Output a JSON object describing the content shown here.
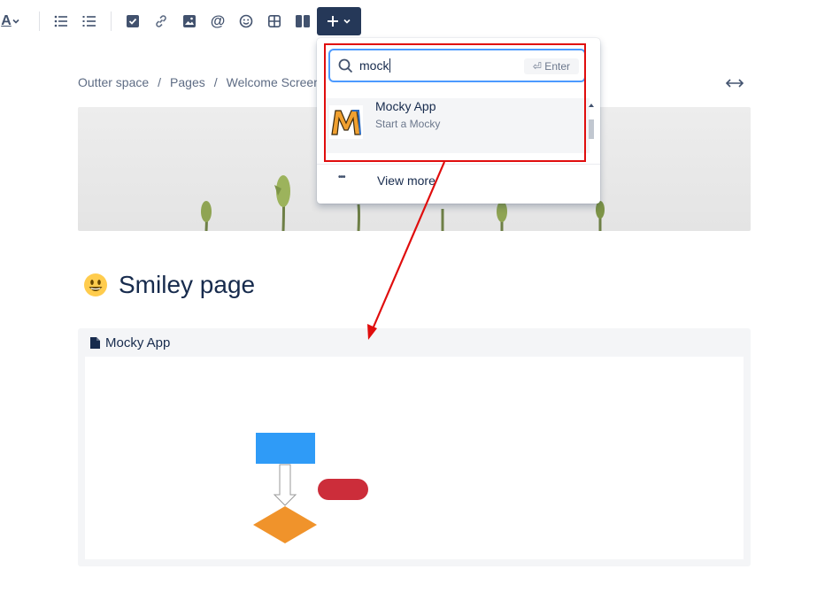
{
  "toolbar": {
    "text_style_icon": "A",
    "items": [
      "text-color-icon",
      "bullet-list-icon",
      "numbered-list-icon",
      "task-icon",
      "link-icon",
      "image-icon",
      "mention-icon",
      "emoji-icon",
      "table-icon",
      "layout-icon"
    ]
  },
  "breadcrumb": {
    "items": [
      "Outter space",
      "Pages",
      "Welcome Screen"
    ],
    "separator": "/"
  },
  "page": {
    "title": "Smiley page",
    "emoji": "😃"
  },
  "insert_menu": {
    "search_value": "mock",
    "enter_hint": "⏎ Enter",
    "results": [
      {
        "title": "Mocky App",
        "subtitle": "Start a Mocky"
      }
    ],
    "view_more": "View more",
    "view_more_icon": "•••"
  },
  "macro": {
    "title": "Mocky App"
  },
  "colors": {
    "accent": "#253858",
    "highlight": "#e00d0d",
    "focus": "#4c9aff",
    "rect": "#2f9bf7",
    "pill": "#cc2d3a",
    "diamond": "#f0932b"
  }
}
